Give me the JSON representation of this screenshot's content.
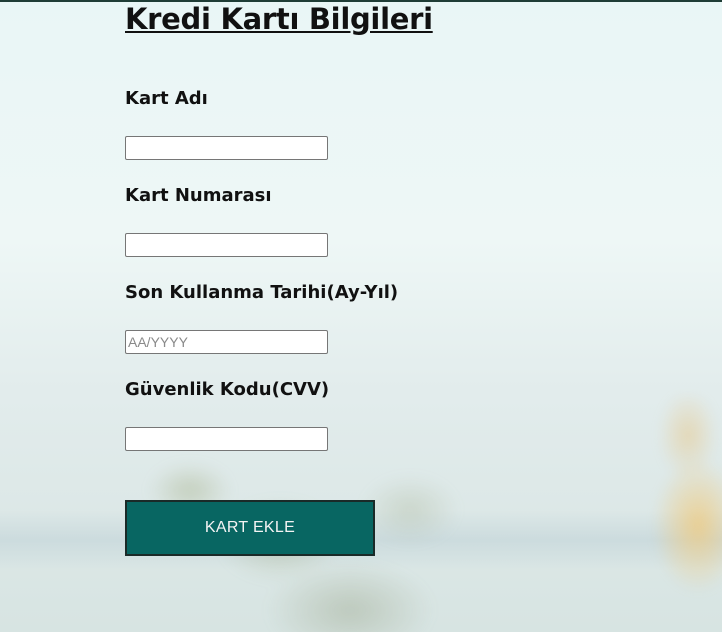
{
  "form": {
    "title": "Kredi Kartı Bilgileri",
    "fields": [
      {
        "label": "Kart Adı",
        "value": "",
        "placeholder": ""
      },
      {
        "label": "Kart Numarası",
        "value": "",
        "placeholder": ""
      },
      {
        "label": "Son Kullanma Tarihi(Ay-Yıl)",
        "value": "",
        "placeholder": "AA/YYYY"
      },
      {
        "label": "Güvenlik Kodu(CVV)",
        "value": "",
        "placeholder": ""
      }
    ],
    "submit_label": "KART EKLE"
  },
  "colors": {
    "accent": "#086662",
    "text": "#111111",
    "background": "#e9f6f6"
  }
}
